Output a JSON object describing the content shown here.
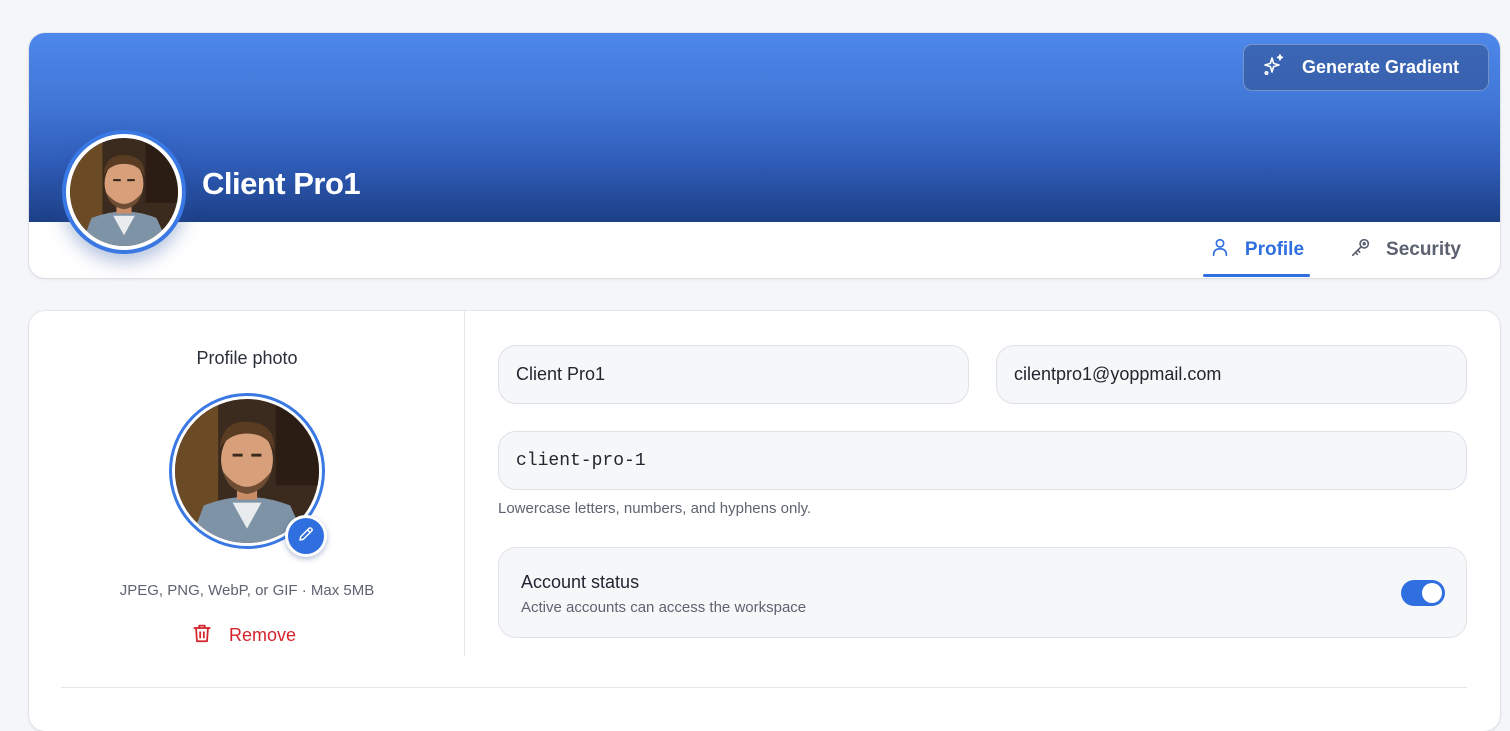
{
  "header": {
    "name": "Client Pro1",
    "generate_button": "Generate Gradient",
    "tabs": [
      {
        "label": "Profile",
        "icon": "user-icon",
        "active": true
      },
      {
        "label": "Security",
        "icon": "key-icon",
        "active": false
      }
    ]
  },
  "photo": {
    "title": "Profile photo",
    "hint": "JPEG, PNG, WebP, or GIF · Max 5MB",
    "remove_label": "Remove"
  },
  "form": {
    "name_value": "Client Pro1",
    "email_value": "cilentpro1@yoppmail.com",
    "slug_value": "client-pro-1",
    "slug_hint": "Lowercase letters, numbers, and hyphens only."
  },
  "account_status": {
    "title": "Account status",
    "subtitle": "Active accounts can access the workspace",
    "enabled": true
  },
  "colors": {
    "accent": "#2f6fe0",
    "danger": "#d4232a",
    "banner_top": "#4d88ea",
    "banner_bottom": "#1d3f86"
  }
}
